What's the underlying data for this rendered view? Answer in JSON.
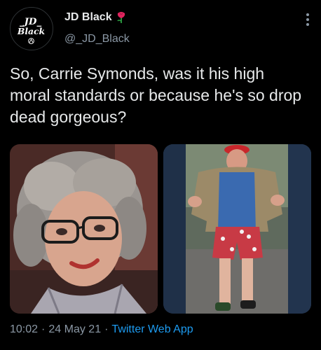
{
  "author": {
    "display_name": "JD Black",
    "handle": "@_JD_Black",
    "avatar_text": "JD Black",
    "badge_icon": "rose-icon"
  },
  "tweet": {
    "text": "So, Carrie Symonds, was it his high moral standards or because he's so drop dead gorgeous?"
  },
  "media": {
    "count": 2
  },
  "meta": {
    "time": "10:02",
    "date": "24 May 21",
    "separator": "·",
    "source": "Twitter Web App"
  },
  "colors": {
    "background": "#000000",
    "text": "#e7e9ea",
    "secondary": "#8b98a5",
    "link": "#1d9bf0"
  }
}
